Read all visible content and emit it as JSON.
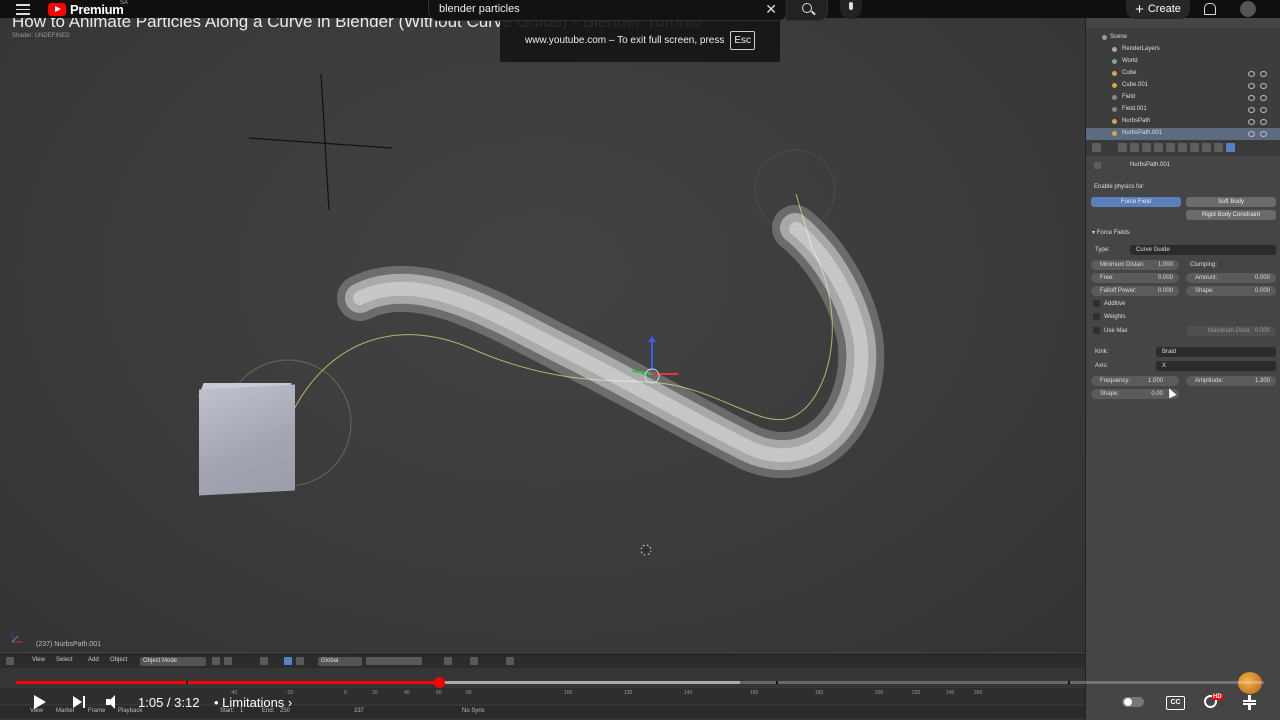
{
  "youtube": {
    "logo_text": "Premium",
    "region": "SA",
    "search_value": "blender particles",
    "create_label": "Create"
  },
  "video": {
    "title": "How to Animate Particles Along a Curve in Blender (Without Curve Guide) - Blender Tutorial",
    "subtitle": "Shader: UNDEFINED",
    "fullscreen_notice": "www.youtube.com – To exit full screen, press",
    "esc_key": "Esc",
    "time": "1:05 / 3:12",
    "chapter": "• Limitations",
    "progress_played": 0.339,
    "progress_buffered": 0.58
  },
  "blender": {
    "viewport_status": "(237) NurbsPath.001",
    "header": {
      "view": "View",
      "select": "Select",
      "add": "Add",
      "object": "Object",
      "mode": "Object Mode",
      "orientation": "Global"
    },
    "timeline": {
      "ticks": [
        "-40",
        "-20",
        "0",
        "20",
        "40",
        "60",
        "80",
        "100",
        "120",
        "140",
        "160",
        "180",
        "200",
        "220",
        "240",
        "260"
      ],
      "row_labels": [
        "View",
        "Marker",
        "Frame",
        "Playback"
      ],
      "start_label": "Start:",
      "start_value": "1",
      "end_label": "End:",
      "end_value": "250",
      "current_frame": "237",
      "sync": "No Sync"
    },
    "outliner": [
      {
        "name": "Scene"
      },
      {
        "name": "RenderLayers"
      },
      {
        "name": "World"
      },
      {
        "name": "Cube"
      },
      {
        "name": "Cube.001"
      },
      {
        "name": "Field"
      },
      {
        "name": "Field.001"
      },
      {
        "name": "NurbsPath"
      },
      {
        "name": "NurbsPath.001"
      }
    ],
    "props": {
      "object_name": "NurbsPath.001",
      "enable_physics": "Enable physics for:",
      "force_field": "Force Field",
      "soft_body": "Soft Body",
      "rigid_body_constraint": "Rigid Body Constraint",
      "section": "Force Fields",
      "type_label": "Type:",
      "type_value": "Curve Guide",
      "min_distance_label": "Minimum Distan:",
      "min_distance_value": "1.000",
      "clumping_label": "Clumping:",
      "free_label": "Free:",
      "free_value": "0.000",
      "amount_label": "Amount:",
      "amount_value": "0.000",
      "falloff_label": "Falloff Power:",
      "falloff_value": "0.000",
      "shape_label": "Shape:",
      "shape_value": "0.000",
      "additive": "Additive",
      "weights": "Weights",
      "use_max": "Use Max",
      "max_distance_label": "Maximum Dista:",
      "max_distance_value": "0.000",
      "kink_label": "Kink:",
      "kink_value": "Braid",
      "axis_label": "Axis:",
      "axis_value": "X",
      "frequency_label": "Frequency:",
      "frequency_value": "1.000",
      "amplitude_label": "Amplitude:",
      "amplitude_value": "1.300",
      "shape2_label": "Shape:",
      "shape2_value": "0.00"
    }
  },
  "colors": {
    "brand_red": "#ff0000",
    "blender_select": "#5b7fb8"
  }
}
